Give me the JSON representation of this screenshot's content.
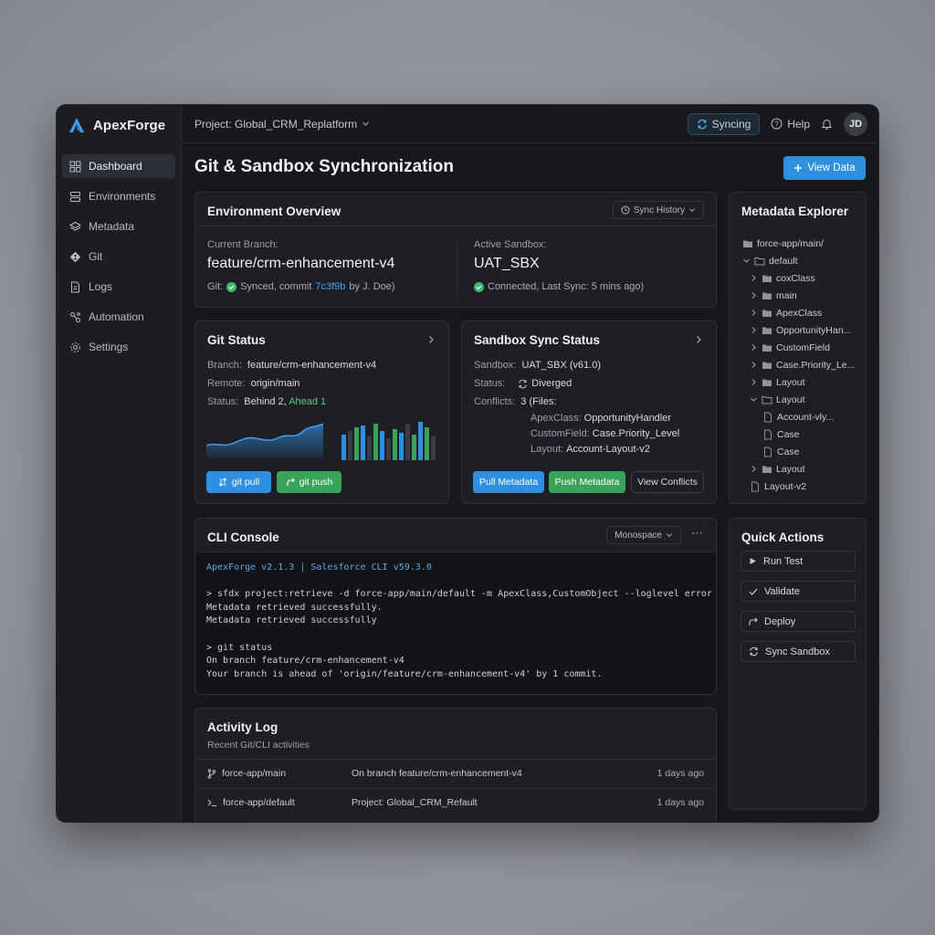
{
  "app": {
    "name": "ApexForge"
  },
  "sidebar": {
    "items": [
      {
        "label": "Dashboard",
        "icon": "grid-icon"
      },
      {
        "label": "Environments",
        "icon": "server-icon"
      },
      {
        "label": "Metadata",
        "icon": "layers-icon"
      },
      {
        "label": "Git",
        "icon": "git-icon"
      },
      {
        "label": "Logs",
        "icon": "file-icon"
      },
      {
        "label": "Automation",
        "icon": "automation-icon"
      },
      {
        "label": "Settings",
        "icon": "gear-icon"
      }
    ]
  },
  "topbar": {
    "project": "Project: Global_CRM_Replatform",
    "sync": "Syncing",
    "help": "Help",
    "avatar": "JD"
  },
  "page": {
    "title": "Git & Sandbox Synchronization",
    "view_data": "View Data"
  },
  "env": {
    "title": "Environment Overview",
    "history": "Sync History",
    "branch_label": "Current Branch:",
    "branch": "feature/crm-enhancement-v4",
    "git_prefix": "Git:",
    "git_text": "Synced, commit",
    "commit": "7c3f9b",
    "git_suffix": "by J. Doe)",
    "sandbox_label": "Active Sandbox:",
    "sandbox": "UAT_SBX",
    "sandbox_status": "Connected, Last Sync: 5 mins ago)"
  },
  "git": {
    "title": "Git Status",
    "branch_label": "Branch:",
    "branch": "feature/crm-enhancement-v4",
    "remote_label": "Remote:",
    "remote": "origin/main",
    "status_label": "Status:",
    "behind": "Behind 2,",
    "ahead": "Ahead 1",
    "pull": "git pull",
    "push": "git push"
  },
  "sandbox": {
    "title": "Sandbox Sync Status",
    "sandbox_label": "Sandbox:",
    "sandbox": "UAT_SBX (v61.0)",
    "status_label": "Status:",
    "status": "Diverged",
    "conflicts_label": "Conflicts:",
    "conflicts_count": "3",
    "conflicts_files": "(Files:",
    "conflicts": [
      {
        "type": "ApexClass:",
        "name": "OpportunityHandler"
      },
      {
        "type": "CustomField:",
        "name": "Case.Priority_Level"
      },
      {
        "type": "Layout:",
        "name": "Account-Layout-v2"
      }
    ],
    "pull": "Pull Metadata",
    "push": "Push Metadata",
    "view": "View Conflicts"
  },
  "meta": {
    "title": "Metadata Explorer",
    "tree": [
      {
        "label": "force-app/main/",
        "level": 0,
        "kind": "folder"
      },
      {
        "label": "default",
        "level": 0,
        "kind": "folder-open",
        "chev": "down"
      },
      {
        "label": "coxClass",
        "level": 1,
        "kind": "folder",
        "chev": "right"
      },
      {
        "label": "main",
        "level": 1,
        "kind": "folder",
        "chev": "right"
      },
      {
        "label": "ApexClass",
        "level": 1,
        "kind": "folder",
        "chev": "right"
      },
      {
        "label": "OpportunityHan...",
        "level": 1,
        "kind": "folder",
        "chev": "right"
      },
      {
        "label": "CustomField",
        "level": 1,
        "kind": "folder",
        "chev": "right"
      },
      {
        "label": "Case.Priority_Le...",
        "level": 1,
        "kind": "folder",
        "chev": "right"
      },
      {
        "label": "Layout",
        "level": 1,
        "kind": "folder",
        "chev": "right"
      },
      {
        "label": "Layout",
        "level": 1,
        "kind": "folder-open",
        "chev": "down"
      },
      {
        "label": "Account-vly...",
        "level": 2,
        "kind": "file"
      },
      {
        "label": "Case",
        "level": 2,
        "kind": "file"
      },
      {
        "label": "Case",
        "level": 2,
        "kind": "file"
      },
      {
        "label": "Layout",
        "level": 1,
        "kind": "folder",
        "chev": "right"
      },
      {
        "label": "Layout-v2",
        "level": 1,
        "kind": "file"
      }
    ]
  },
  "cli": {
    "title": "CLI Console",
    "font": "Monospace",
    "banner": "ApexForge v2.1.3 | Salesforce CLI v59.3.0",
    "lines": [
      "",
      "> sfdx project:retrieve -d force-app/main/default -m ApexClass,CustomObject --loglevel error",
      "Metadata retrieved successfully.",
      "Metadata retrieved successfully",
      "",
      "> git status",
      "On branch feature/crm-enhancement-v4",
      "Your branch is ahead of 'origin/feature/crm-enhancement-v4' by 1 commit."
    ]
  },
  "quick": {
    "title": "Quick Actions",
    "actions": [
      {
        "label": "Run Test",
        "icon": "play-icon"
      },
      {
        "label": "Validate",
        "icon": "check-icon"
      },
      {
        "label": "Deploy",
        "icon": "deploy-icon"
      },
      {
        "label": "Sync Sandbox",
        "icon": "sync-icon"
      }
    ]
  },
  "activity": {
    "title": "Activity Log",
    "subtitle": "Recent Git/CLI activities",
    "rows": [
      {
        "icon": "branch-icon",
        "path": "force-app/main",
        "message": "On branch feature/crm-enhancement-v4",
        "time": "1 days ago"
      },
      {
        "icon": "terminal-icon",
        "path": "force-app/default",
        "message": "Project: Global_CRM_Refault",
        "time": "1 days ago"
      }
    ]
  },
  "colors": {
    "accent": "#2f8fe0",
    "success": "#3aa35a",
    "warning": "#e8a14c"
  }
}
